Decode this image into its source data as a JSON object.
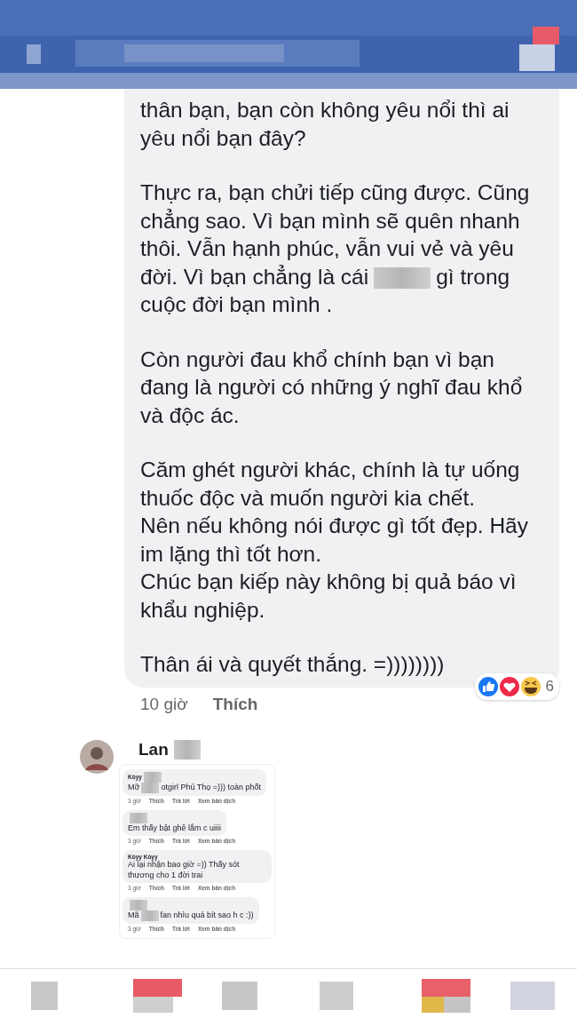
{
  "comment": {
    "paragraphs": [
      {
        "parts": [
          {
            "kind": "block",
            "text": "thân bạn, bạn còn không yêu nổi thì ai yêu nổi bạn đây?"
          }
        ]
      },
      {
        "parts": [
          {
            "kind": "block",
            "text": "Thực ra, bạn chửi tiếp cũng được. Cũng chẳng sao. Vì bạn mình sẽ quên nhanh thôi. Vẫn hạnh phúc, vẫn vui vẻ và yêu"
          },
          {
            "kind": "text",
            "text": "đời. Vì bạn chẳng là cái"
          },
          {
            "kind": "redacted"
          },
          {
            "kind": "text",
            "text": "gì trong"
          },
          {
            "kind": "block",
            "text": "cuộc đời bạn mình ."
          }
        ]
      },
      {
        "parts": [
          {
            "kind": "block",
            "text": "Còn người đau khổ chính bạn vì bạn đang là người có những ý nghĩ đau khổ và độc ác."
          }
        ]
      },
      {
        "parts": [
          {
            "kind": "block",
            "text": "Căm ghét người khác, chính là tự uống thuốc độc và muốn người kia chết.\nNên nếu không nói được gì tốt đẹp. Hãy im lặng thì tốt hơn.\nChúc bạn kiếp này không bị quả báo vì khẩu nghiệp."
          }
        ]
      },
      {
        "parts": [
          {
            "kind": "block",
            "text": "Thân ái và quyết thắng. =))))))))"
          }
        ]
      }
    ],
    "time": "10 giờ",
    "like_label": "Thích",
    "reaction_count": "6"
  },
  "reply": {
    "name_parts": [
      {
        "kind": "text",
        "text": "Lan"
      },
      {
        "kind": "redacted"
      }
    ],
    "screenshot": [
      {
        "name_parts": [
          {
            "kind": "text",
            "text": "Kòyy"
          },
          {
            "kind": "redacted"
          }
        ],
        "parts": [
          {
            "kind": "text",
            "text": "Mỡ"
          },
          {
            "kind": "redacted"
          },
          {
            "kind": "text",
            "text": "otgirl Phú Thọ =))) toàn phốt"
          }
        ],
        "actions": [
          "3 giờ",
          "Thích",
          "Trả lời",
          "Xem bản dịch"
        ]
      },
      {
        "name_parts": [
          {
            "kind": "redacted"
          }
        ],
        "parts": [
          {
            "kind": "block",
            "text": "Em thấy bật ghê lắm c uiiii"
          }
        ],
        "actions": [
          "3 giờ",
          "Thích",
          "Trả lời",
          "Xem bản dịch"
        ]
      },
      {
        "name_parts": [
          {
            "kind": "text",
            "text": "Kòyy Kòyy"
          }
        ],
        "parts": [
          {
            "kind": "block",
            "text": "Ai lại nhận bao giờ =)) Thấy sót thương cho 1 đời trai"
          }
        ],
        "actions": [
          "3 giờ",
          "Thích",
          "Trả lời",
          "Xem bản dịch"
        ]
      },
      {
        "name_parts": [
          {
            "kind": "redacted"
          }
        ],
        "parts": [
          {
            "kind": "text",
            "text": "Mã"
          },
          {
            "kind": "redacted"
          },
          {
            "kind": "text",
            "text": "fan nhìu quá bít sao h c :))"
          }
        ],
        "actions": [
          "3 giờ",
          "Thích",
          "Trả lời",
          "Xem bản dịch"
        ]
      }
    ]
  }
}
